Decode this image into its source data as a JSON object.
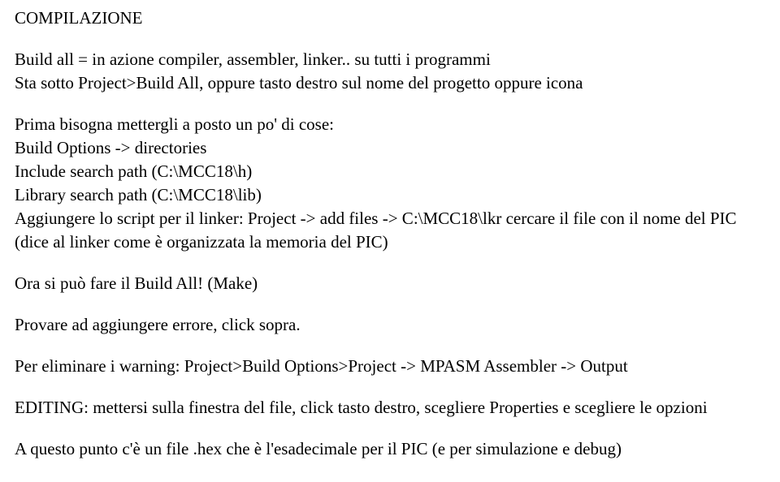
{
  "title": "COMPILAZIONE",
  "p1": "Build all = in azione compiler, assembler, linker..   su tutti i programmi",
  "p2": "Sta sotto Project>Build All, oppure tasto destro sul nome del progetto oppure icona",
  "p3": "Prima bisogna mettergli a posto un po' di cose:",
  "p4": "Build Options -> directories",
  "p5": "Include search path  (C:\\MCC18\\h)",
  "p6": "Library search path  (C:\\MCC18\\lib)",
  "p7": "Aggiungere lo script per il linker: Project -> add files -> C:\\MCC18\\lkr cercare il file con il nome del PIC (dice al linker come è organizzata la memoria del PIC)",
  "p8": "Ora si può fare il Build All!  (Make)",
  "p9": "Provare ad aggiungere errore, click sopra.",
  "p10": "Per eliminare i warning: Project>Build Options>Project -> MPASM Assembler -> Output",
  "p11": "EDITING: mettersi sulla finestra del file, click tasto destro, scegliere Properties e scegliere le opzioni",
  "p12": "A questo punto c'è un file .hex che è l'esadecimale per il PIC (e per simulazione e debug)"
}
